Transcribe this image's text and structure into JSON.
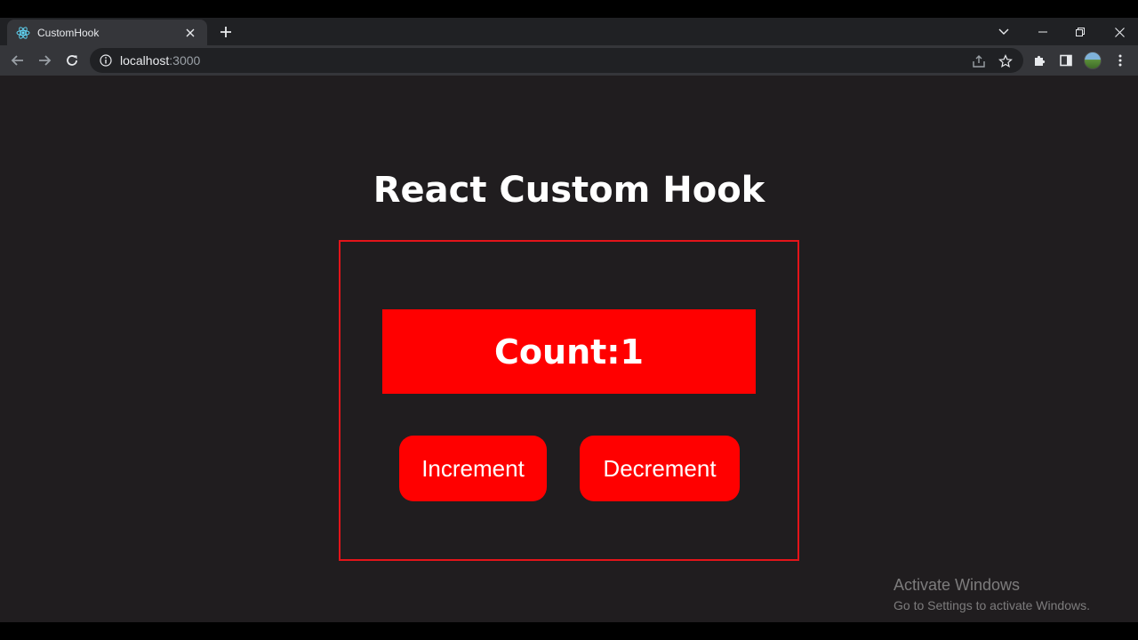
{
  "browser": {
    "tab": {
      "title": "CustomHook",
      "favicon": "react-icon"
    },
    "address": {
      "host": "localhost",
      "port": ":3000"
    },
    "colors": {
      "tabstrip": "#202124",
      "toolbar": "#35363a",
      "omnibox": "#202124"
    }
  },
  "page": {
    "title": "React Custom Hook",
    "counter": {
      "label": "Count:",
      "value": "1"
    },
    "buttons": {
      "increment": "Increment",
      "decrement": "Decrement"
    },
    "colors": {
      "background": "#201d1f",
      "accent": "#ff0000",
      "card_border": "#e3141a",
      "text": "#ffffff"
    }
  },
  "watermark": {
    "title": "Activate Windows",
    "subtitle": "Go to Settings to activate Windows."
  }
}
